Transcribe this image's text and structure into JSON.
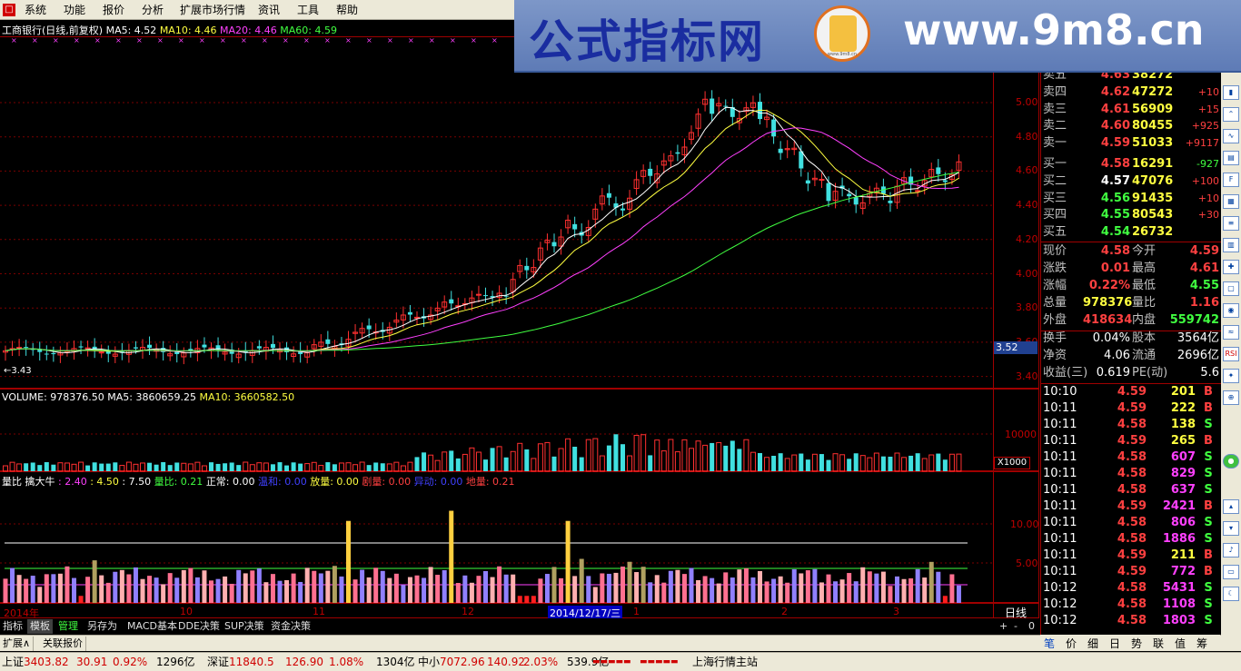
{
  "menu": [
    "系统",
    "功能",
    "报价",
    "分析",
    "扩展市场行情",
    "资讯",
    "工具",
    "帮助"
  ],
  "banner": {
    "left_text": "公式指标网",
    "logo_text": "www.9m8.cn",
    "right_text": "www.9m8.cn"
  },
  "chart_title": {
    "name": "工商银行(日线,前复权)",
    "ma5": "MA5: 4.52",
    "ma10": "MA10: 4.46",
    "ma20": "MA20: 4.46",
    "ma60": "MA60: 4.59"
  },
  "price_axis": [
    "5.00",
    "4.80",
    "4.60",
    "4.40",
    "4.20",
    "4.00",
    "3.80",
    "3.60",
    "3.40"
  ],
  "current_price_tag": "3.52",
  "low_marker": "3.43",
  "volume_title": {
    "name": "VOLUME: 978376.50",
    "ma5": "MA5: 3860659.25",
    "ma10": "MA10: 3660582.50"
  },
  "volume_axis": [
    "10000"
  ],
  "volume_unit": "X1000",
  "indicator_title": {
    "name": "量比 擒大牛",
    "a": ": 2.40",
    "b": ": 4.50",
    "c": ": 7.50",
    "liangbi": "量比: 0.21",
    "zhengchang": "正常: 0.00",
    "wenhe": "温和: 0.00",
    "fangliang": "放量: 0.00",
    "juliang": "剧量: 0.00",
    "yichang": "异动: 0.00",
    "diliang": "地量: 0.21"
  },
  "indicator_axis": [
    "10.00",
    "5.00"
  ],
  "x_labels": [
    "2014年",
    "10",
    "11",
    "12",
    "2014/12/17/三",
    "1",
    "2",
    "3"
  ],
  "period_label": "日线",
  "bottom_tabs": [
    "指标",
    "模板",
    "管理",
    "另存为",
    "MACD基本",
    "DDE决策",
    "SUP决策",
    "资金决策"
  ],
  "bottom_tabs2": [
    "扩展∧",
    "关联报价"
  ],
  "zoom_controls": [
    "+",
    "-",
    "0"
  ],
  "orderbook": {
    "asks": [
      {
        "label": "卖五",
        "price": "4.63",
        "vol": "38272",
        "chg": ""
      },
      {
        "label": "卖四",
        "price": "4.62",
        "vol": "47272",
        "chg": "+10"
      },
      {
        "label": "卖三",
        "price": "4.61",
        "vol": "56909",
        "chg": "+15"
      },
      {
        "label": "卖二",
        "price": "4.60",
        "vol": "80455",
        "chg": "+925"
      },
      {
        "label": "卖一",
        "price": "4.59",
        "vol": "51033",
        "chg": "+9117"
      }
    ],
    "bids": [
      {
        "label": "买一",
        "price": "4.58",
        "vol": "16291",
        "chg": "-927"
      },
      {
        "label": "买二",
        "price": "4.57",
        "vol": "47076",
        "chg": "+100"
      },
      {
        "label": "买三",
        "price": "4.56",
        "vol": "91435",
        "chg": "+10"
      },
      {
        "label": "买四",
        "price": "4.55",
        "vol": "80543",
        "chg": "+30"
      },
      {
        "label": "买五",
        "price": "4.54",
        "vol": "26732",
        "chg": ""
      }
    ]
  },
  "quote": [
    {
      "l1": "现价",
      "v1": "4.58",
      "l2": "今开",
      "v2": "4.59"
    },
    {
      "l1": "涨跌",
      "v1": "0.01",
      "l2": "最高",
      "v2": "4.61"
    },
    {
      "l1": "涨幅",
      "v1": "0.22%",
      "l2": "最低",
      "v2": "4.55"
    },
    {
      "l1": "总量",
      "v1": "978376",
      "l2": "量比",
      "v2": "1.16"
    },
    {
      "l1": "外盘",
      "v1": "418634",
      "l2": "内盘",
      "v2": "559742"
    }
  ],
  "fund": [
    {
      "l1": "换手",
      "v1": "0.04%",
      "l2": "股本",
      "v2": "3564亿"
    },
    {
      "l1": "净资",
      "v1": "4.06",
      "l2": "流通",
      "v2": "2696亿"
    },
    {
      "l1": "收益(三)",
      "v1": "0.619",
      "l2": "PE(动)",
      "v2": "5.6"
    }
  ],
  "ticks": [
    {
      "t": "10:10",
      "p": "4.59",
      "v": "201",
      "bs": "B"
    },
    {
      "t": "10:11",
      "p": "4.59",
      "v": "222",
      "bs": "B"
    },
    {
      "t": "10:11",
      "p": "4.58",
      "v": "138",
      "bs": "S"
    },
    {
      "t": "10:11",
      "p": "4.59",
      "v": "265",
      "bs": "B"
    },
    {
      "t": "10:11",
      "p": "4.58",
      "v": "607",
      "bs": "S"
    },
    {
      "t": "10:11",
      "p": "4.58",
      "v": "829",
      "bs": "S"
    },
    {
      "t": "10:11",
      "p": "4.58",
      "v": "637",
      "bs": "S"
    },
    {
      "t": "10:11",
      "p": "4.59",
      "v": "2421",
      "bs": "B"
    },
    {
      "t": "10:11",
      "p": "4.58",
      "v": "806",
      "bs": "S"
    },
    {
      "t": "10:11",
      "p": "4.58",
      "v": "1886",
      "bs": "S"
    },
    {
      "t": "10:11",
      "p": "4.59",
      "v": "211",
      "bs": "B"
    },
    {
      "t": "10:11",
      "p": "4.59",
      "v": "772",
      "bs": "B"
    },
    {
      "t": "10:12",
      "p": "4.58",
      "v": "5431",
      "bs": "S"
    },
    {
      "t": "10:12",
      "p": "4.58",
      "v": "1108",
      "bs": "S"
    },
    {
      "t": "10:12",
      "p": "4.58",
      "v": "1803",
      "bs": "S"
    }
  ],
  "rp_tabs": [
    "笔",
    "价",
    "细",
    "日",
    "势",
    "联",
    "值",
    "筹"
  ],
  "status": {
    "sh_label": "上证",
    "sh_val": "3403.82",
    "sh_chg": "30.91",
    "sh_pct": "0.92%",
    "sh_amt": "1296亿",
    "sz_label": "深证",
    "sz_val": "11840.5",
    "sz_chg": "126.90",
    "sz_pct": "1.08%",
    "sz_amt": "1304亿",
    "zx_label": "中小",
    "zx_val": "7072.96",
    "zx_chg": "140.92",
    "zx_pct": "2.03%",
    "zx_amt": "539.9亿",
    "station": "上海行情主站"
  },
  "colors": {
    "up": "#ff3030",
    "down": "#40e0e0",
    "ma5": "#ffffff",
    "ma10": "#ffff40",
    "ma20": "#ff40ff",
    "ma60": "#40ff40",
    "grid": "#7a0000"
  }
}
